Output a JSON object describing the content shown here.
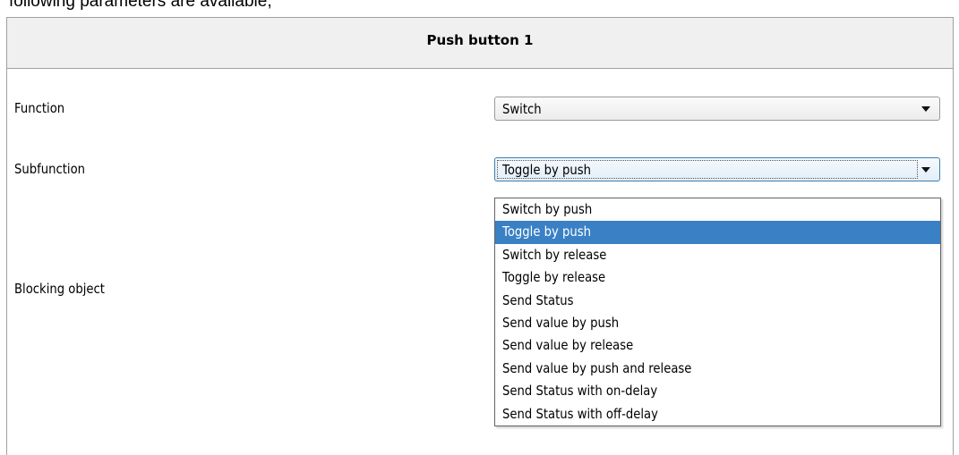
{
  "caption": "following parameters are available,",
  "panel": {
    "title": "Push button 1"
  },
  "fields": {
    "function_label": "Function",
    "function_value": "Switch",
    "subfunction_label": "Subfunction",
    "subfunction_value": "Toggle by push",
    "blocking_label": "Blocking object"
  },
  "dropdown": {
    "selected_index": 1,
    "options": [
      "Switch by push",
      "Toggle by push",
      "Switch by release",
      "Toggle by release",
      "Send Status",
      "Send value by push",
      "Send value by release",
      "Send value by push and release",
      "Send Status with on-delay",
      "Send Status with off-delay"
    ]
  },
  "colors": {
    "selection": "#3a80c4",
    "header_bg": "#f0f0f0",
    "focus_border": "#3c7fb1"
  }
}
